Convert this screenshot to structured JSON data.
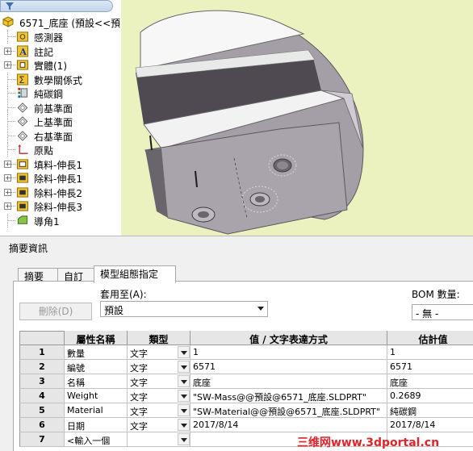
{
  "tree": {
    "root_label": "6571_底座 (預設<<預",
    "items": [
      {
        "label": "感測器",
        "icon": "sensor-folder-icon",
        "expandable": false
      },
      {
        "label": "註記",
        "icon": "annotation-icon",
        "expandable": true
      },
      {
        "label": "實體(1)",
        "icon": "solid-bodies-icon",
        "expandable": true
      },
      {
        "label": "數學關係式",
        "icon": "equations-icon",
        "expandable": false
      },
      {
        "label": "純碳鋼",
        "icon": "material-icon",
        "expandable": false
      },
      {
        "label": "前基準面",
        "icon": "plane-icon",
        "expandable": false
      },
      {
        "label": "上基準面",
        "icon": "plane-icon",
        "expandable": false
      },
      {
        "label": "右基準面",
        "icon": "plane-icon",
        "expandable": false
      },
      {
        "label": "原點",
        "icon": "origin-icon",
        "expandable": false
      },
      {
        "label": "填料-伸長1",
        "icon": "extrude-boss-icon",
        "expandable": true
      },
      {
        "label": "除料-伸長1",
        "icon": "extrude-cut-icon",
        "expandable": true
      },
      {
        "label": "除料-伸長2",
        "icon": "extrude-cut-icon",
        "expandable": true
      },
      {
        "label": "除料-伸長3",
        "icon": "extrude-cut-icon",
        "expandable": true
      },
      {
        "label": "導角1",
        "icon": "chamfer-icon",
        "expandable": false
      }
    ]
  },
  "dialog": {
    "title": "摘要資訊",
    "tabs": [
      {
        "label": "摘要",
        "active": false
      },
      {
        "label": "自訂",
        "active": false
      },
      {
        "label": "模型組態指定",
        "active": true
      }
    ],
    "apply_to_label": "套用至(A):",
    "apply_to_value": "預設",
    "delete_button": "刪除(D)",
    "bom_label": "BOM 數量:",
    "bom_value": "- 無 -",
    "grid": {
      "headers": [
        "",
        "屬性名稱",
        "類型",
        "值 / 文字表達方式",
        "估計值"
      ],
      "rows": [
        {
          "num": "1",
          "name": "數量",
          "type": "文字",
          "expr": "1",
          "value": "1"
        },
        {
          "num": "2",
          "name": "編號",
          "type": "文字",
          "expr": "6571",
          "value": "6571"
        },
        {
          "num": "3",
          "name": "名稱",
          "type": "文字",
          "expr": "底座",
          "value": "底座"
        },
        {
          "num": "4",
          "name": "Weight",
          "type": "文字",
          "expr": "\"SW-Mass@@預設@6571_底座.SLDPRT\"",
          "value": "0.2689"
        },
        {
          "num": "5",
          "name": "Material",
          "type": "文字",
          "expr": "\"SW-Material@@預設@6571_底座.SLDPRT\"",
          "value": "純碳鋼"
        },
        {
          "num": "6",
          "name": "日期",
          "type": "文字",
          "expr": "2017/8/14",
          "value": "2017/8/14"
        },
        {
          "num": "7",
          "name": "<輸入一個",
          "type": "",
          "expr": "",
          "value": ""
        }
      ]
    }
  },
  "watermark": "三维网www.3dportal.cn",
  "colors": {
    "viewport_bg": "#ecf2bf",
    "part_light": "#f7f7f7",
    "part_mid": "#a29da3",
    "part_dark": "#4d484f",
    "watermark": "#e0242a"
  }
}
